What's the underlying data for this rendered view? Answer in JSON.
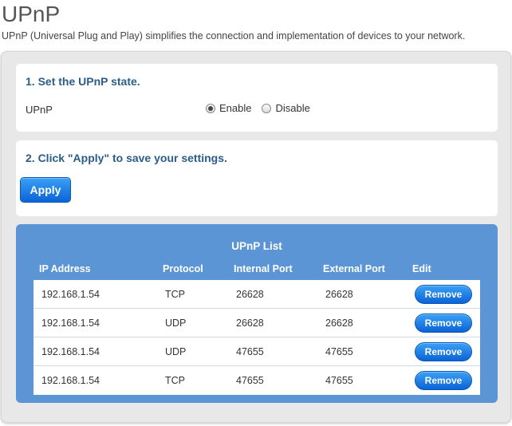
{
  "page": {
    "title": "UPnP",
    "description": "UPnP (Universal Plug and Play) simplifies the connection and implementation of devices to your network."
  },
  "state_section": {
    "heading": "1. Set the UPnP state.",
    "field_label": "UPnP",
    "options": [
      {
        "label": "Enable",
        "checked": true
      },
      {
        "label": "Disable",
        "checked": false
      }
    ]
  },
  "apply_section": {
    "heading": "2. Click \"Apply\" to save your settings.",
    "button_label": "Apply"
  },
  "upnp_list": {
    "title": "UPnP List",
    "columns": [
      "IP Address",
      "Protocol",
      "Internal Port",
      "External Port",
      "Edit"
    ],
    "rows": [
      {
        "ip": "192.168.1.54",
        "protocol": "TCP",
        "internal_port": "26628",
        "external_port": "26628",
        "action": "Remove"
      },
      {
        "ip": "192.168.1.54",
        "protocol": "UDP",
        "internal_port": "26628",
        "external_port": "26628",
        "action": "Remove"
      },
      {
        "ip": "192.168.1.54",
        "protocol": "UDP",
        "internal_port": "47655",
        "external_port": "47655",
        "action": "Remove"
      },
      {
        "ip": "192.168.1.54",
        "protocol": "TCP",
        "internal_port": "47655",
        "external_port": "47655",
        "action": "Remove"
      }
    ]
  },
  "colors": {
    "accent_button": "#0b64d6",
    "list_panel": "#5b95d6",
    "heading": "#2a5d8a"
  }
}
